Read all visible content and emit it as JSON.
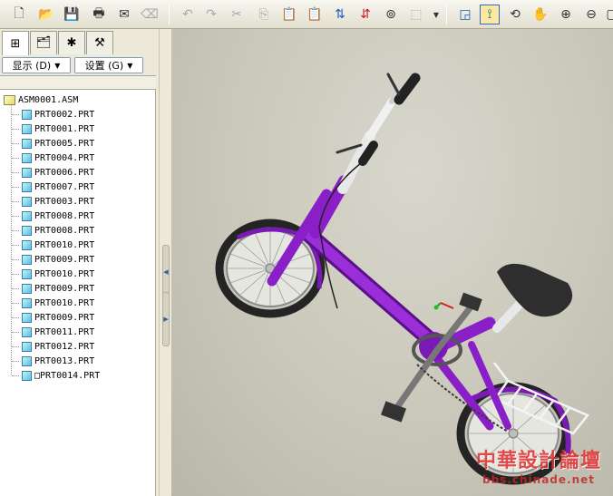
{
  "toolbar": {
    "icons": [
      "new-file-icon",
      "open-folder-icon",
      "save-icon",
      "print-icon",
      "send-icon",
      "erase-icon",
      "undo-icon",
      "redo-icon",
      "cut-icon",
      "copy-icon",
      "paste-icon",
      "paste-special-icon",
      "regenerate-icon",
      "regenerate-manager-icon",
      "find-icon",
      "select-box-icon",
      "refit-icon",
      "datum-display-icon",
      "spin-center-icon",
      "pan-icon",
      "zoom-in-icon",
      "zoom-out-icon",
      "view-icon"
    ]
  },
  "nav_tabs": [
    "model-tree-icon",
    "folder-browser-icon",
    "favorites-icon",
    "connections-icon"
  ],
  "dropdowns": {
    "show_label": "显示 (D)",
    "settings_label": "设置 (G)"
  },
  "tree": {
    "root": "ASM0001.ASM",
    "items": [
      "PRT0002.PRT",
      "PRT0001.PRT",
      "PRT0005.PRT",
      "PRT0004.PRT",
      "PRT0006.PRT",
      "PRT0007.PRT",
      "PRT0003.PRT",
      "PRT0008.PRT",
      "PRT0008.PRT",
      "PRT0010.PRT",
      "PRT0009.PRT",
      "PRT0010.PRT",
      "PRT0009.PRT",
      "PRT0010.PRT",
      "PRT0009.PRT",
      "PRT0011.PRT",
      "PRT0012.PRT",
      "PRT0013.PRT",
      "□PRT0014.PRT"
    ]
  },
  "colors": {
    "frame": "#8a1fc8",
    "frame_dark": "#5b0f8a",
    "tire": "#2a2a2a",
    "seat": "#303030",
    "chrome": "#e8e8e8"
  },
  "watermark": {
    "title": "中華設計論壇",
    "url": "bbs.chinade.net"
  }
}
